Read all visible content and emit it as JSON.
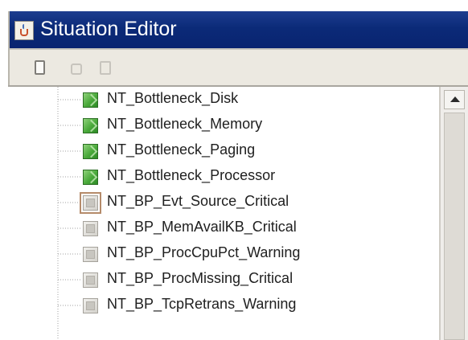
{
  "window": {
    "title": "Situation Editor",
    "title_icon": "java-cup-icon"
  },
  "toolbar": {
    "buttons": [
      {
        "icon": "new-document-icon",
        "enabled": true
      },
      {
        "icon": "copy-document-icon",
        "enabled": false
      },
      {
        "icon": "paste-document-icon",
        "enabled": false
      }
    ]
  },
  "tree": {
    "items": [
      {
        "label": "NT_Bottleneck_Disk",
        "icon": "green-situation-icon",
        "state": "enabled"
      },
      {
        "label": "NT_Bottleneck_Memory",
        "icon": "green-situation-icon",
        "state": "enabled"
      },
      {
        "label": "NT_Bottleneck_Paging",
        "icon": "green-situation-icon",
        "state": "enabled"
      },
      {
        "label": "NT_Bottleneck_Processor",
        "icon": "green-situation-icon",
        "state": "enabled"
      },
      {
        "label": "NT_BP_Evt_Source_Critical",
        "icon": "grey-situation-icon",
        "state": "disabled",
        "focused": true
      },
      {
        "label": "NT_BP_MemAvailKB_Critical",
        "icon": "grey-situation-icon",
        "state": "disabled"
      },
      {
        "label": "NT_BP_ProcCpuPct_Warning",
        "icon": "grey-situation-icon",
        "state": "disabled"
      },
      {
        "label": "NT_BP_ProcMissing_Critical",
        "icon": "grey-situation-icon",
        "state": "disabled"
      },
      {
        "label": "NT_BP_TcpRetrans_Warning",
        "icon": "grey-situation-icon",
        "state": "disabled"
      }
    ]
  },
  "colors": {
    "titlebar": "#0b2a78",
    "enabled_icon": "#49a93a",
    "disabled_icon": "#d4d2cc",
    "window_bg": "#ece9e1"
  }
}
